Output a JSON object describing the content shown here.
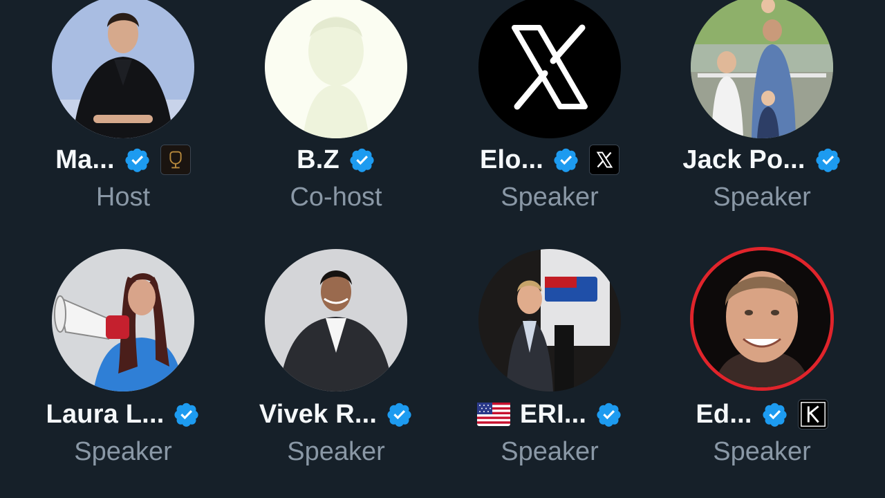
{
  "participants": [
    {
      "name": "Ma...",
      "role": "Host",
      "verified": true,
      "affiliate_badge": "microphone-logo-icon"
    },
    {
      "name": "B.Z",
      "role": "Co-host",
      "verified": true
    },
    {
      "name": "Elo...",
      "role": "Speaker",
      "verified": true,
      "affiliate_badge": "x-logo-icon"
    },
    {
      "name": "Jack Po...",
      "role": "Speaker",
      "verified": true
    },
    {
      "name": "Laura L...",
      "role": "Speaker",
      "verified": true
    },
    {
      "name": "Vivek R...",
      "role": "Speaker",
      "verified": true
    },
    {
      "name": "ERI...",
      "role": "Speaker",
      "verified": true,
      "name_prefix_icon": "us-flag-icon"
    },
    {
      "name": "Ed...",
      "role": "Speaker",
      "verified": true,
      "affiliate_badge": "k-logo-icon",
      "speaking": true
    }
  ],
  "colors": {
    "background": "#162029",
    "verified_blue": "#1d9bf0",
    "speaking_ring": "#e0242b",
    "role_text": "#8a98a6",
    "name_text": "#f5f8fa"
  }
}
